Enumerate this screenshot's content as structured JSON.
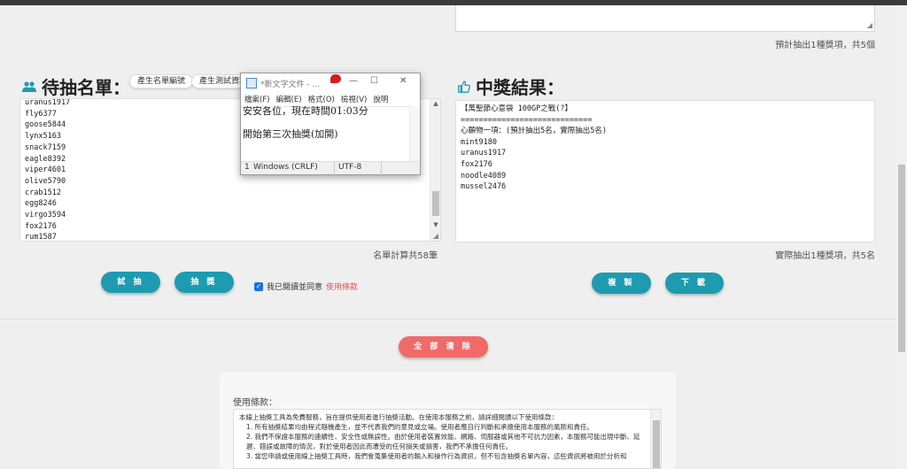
{
  "top": {
    "summary": "預計抽出1種獎項，共5個"
  },
  "left": {
    "title": "待抽名單：",
    "pills": [
      "產生名單編號",
      "產生測試資料"
    ],
    "names": [
      "uranus1917",
      "fly6377",
      "goose5844",
      "lynx5163",
      "snack7159",
      "eagle8392",
      "viper4601",
      "olive5790",
      "crab1512",
      "egg8246",
      "virgo3594",
      "fox2176",
      "rum1587"
    ],
    "count": "名單計算共58筆",
    "btn_try": "試 抽",
    "btn_draw": "抽 獎",
    "agree_text": "我已閱讀並同意",
    "agree_link": "使用條款"
  },
  "right": {
    "title": "中獎結果：",
    "lines": [
      "【萬聖節心意袋 100GP之戰(?】",
      "=============================",
      "心願物一項：(預計抽出5名，實際抽出5名)",
      "mint9180",
      "uranus1917",
      "fox2176",
      "noodle4089",
      "mussel2476"
    ],
    "count": "實際抽出1種獎項，共5名",
    "btn_copy": "複 製",
    "btn_download": "下 載"
  },
  "clear_all": "全 部 清 除",
  "terms": {
    "title": "使用條款：",
    "intro": "本線上抽獎工具為免費服務，旨在提供使用者進行抽獎活動。在使用本服務之前，請詳細閱讀以下使用條款：",
    "items": [
      "1.  所有抽獎結果均由程式隨機產生，並不代表我們的意見或立場。使用者應自行判斷和承擔使用本服務的風險和責任。",
      "2.  我們不保證本服務的連續性、安全性或無誤性。由於使用者裝置效能、網路、伺服器或其他不可抗力因素，本服務可能出現中斷、延遲、錯誤或故障的情況，對於使用者因此而遭受的任何損失或損害，我們不承擔任何責任。",
      "3.  當您申請或使用線上抽獎工具時，我們會蒐集使用者的輸入和操作行為資訊，但不包含抽獎名單內容，這些資訊將被用於分析和"
    ]
  },
  "notepad": {
    "title": "*新文字文件 - ...",
    "menu": [
      "檔案(F)",
      "編輯(E)",
      "格式(O)",
      "檢視(V)",
      "說明"
    ],
    "line1": "安安各位，現在時間01:03分",
    "line2": "開始第三次抽獎(加開)",
    "status_pos": "1",
    "status_eol": "Windows (CRLF)",
    "status_enc": "UTF-8"
  },
  "colors": {
    "accent": "#1e9bb0",
    "danger": "#f06a6a",
    "link": "#e05555"
  }
}
